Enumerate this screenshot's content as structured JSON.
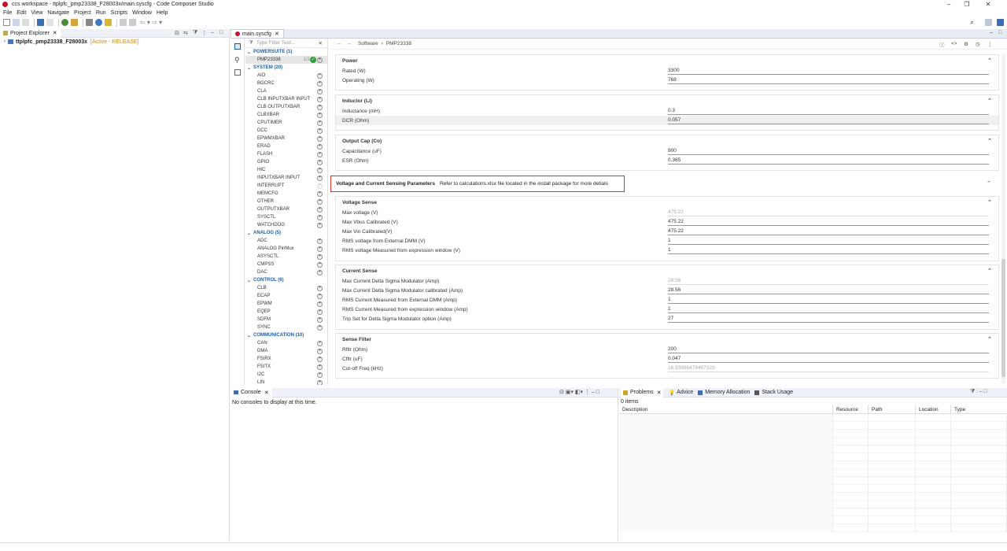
{
  "window": {
    "title": "ccs workspace - ttplpfc_pmp23338_F28003x/main.syscfg - Code Composer Studio"
  },
  "menu": [
    "File",
    "Edit",
    "View",
    "Navigate",
    "Project",
    "Run",
    "Scripts",
    "Window",
    "Help"
  ],
  "project_explorer": {
    "tab_label": "Project Explorer",
    "project_name": "ttplpfc_pmp23338_F28003x",
    "project_status": "[Active - RELEASE]"
  },
  "editor": {
    "tab_label": "main.syscfg"
  },
  "left_panel": {
    "filter_placeholder": "Type Filter Text...",
    "categories": [
      {
        "name": "POWERSUITE (1)",
        "modules": [
          {
            "name": "PMP23338",
            "count": "1/1"
          }
        ]
      },
      {
        "name": "SYSTEM (20)",
        "modules": [
          "AIO",
          "BGCRC",
          "CLA",
          "CLB INPUTXBAR INPUT",
          "CLB OUTPUTXBAR",
          "CLBXBAR",
          "CPUTIMER",
          "DCC",
          "EPWMXBAR",
          "ERAD",
          "FLASH",
          "GPIO",
          "HIC",
          "INPUTXBAR INPUT",
          "INTERRUPT",
          "MEMCFG",
          "OTHER",
          "OUTPUTXBAR",
          "SYSCTL",
          "WATCHDOG"
        ]
      },
      {
        "name": "ANALOG (5)",
        "modules": [
          "ADC",
          "ANALOG PinMux",
          "ASYSCTL",
          "CMPSS",
          "DAC"
        ]
      },
      {
        "name": "CONTROL (6)",
        "modules": [
          "CLB",
          "ECAP",
          "EPWM",
          "EQEP",
          "SDFM",
          "SYNC"
        ]
      },
      {
        "name": "COMMUNICATION (10)",
        "modules": [
          "CAN",
          "DMA",
          "FSIRX",
          "FSITX",
          "I2C",
          "LIN"
        ]
      }
    ]
  },
  "breadcrumb": {
    "root": "Software",
    "leaf": "PMP23338"
  },
  "sections": {
    "power": {
      "title": "Power",
      "fields": [
        {
          "label": "Rated (W)",
          "value": "3300"
        },
        {
          "label": "Operating (W)",
          "value": "768"
        }
      ]
    },
    "inductor": {
      "title": "Inductor (Li)",
      "fields": [
        {
          "label": "Inductance (mH)",
          "value": "0.3"
        },
        {
          "label": "DCR (Ohm)",
          "value": "0.057"
        }
      ]
    },
    "output_cap": {
      "title": "Output Cap (Co)",
      "fields": [
        {
          "label": "Capacitance (uF)",
          "value": "900"
        },
        {
          "label": "ESR (Ohm)",
          "value": "0.365"
        }
      ]
    },
    "vcsp": {
      "title": "Voltage and Current Sensing Parameters",
      "note": "Refer to calculations.xlsx file located in the install package for more detials"
    },
    "voltage_sense": {
      "title": "Voltage Sense",
      "fields": [
        {
          "label": "Max voltage (V)",
          "value": "475.22",
          "readonly": true
        },
        {
          "label": "Max Vbus Calibrated (V)",
          "value": "475.22"
        },
        {
          "label": "Max Vin Calibrated(V)",
          "value": "475.22"
        },
        {
          "label": "RMS voltage from External DMM (V)",
          "value": "1"
        },
        {
          "label": "RMS voltage Measured from expression window (V)",
          "value": "1"
        }
      ]
    },
    "current_sense": {
      "title": "Current Sense",
      "fields": [
        {
          "label": "Max Current Delta Sigma Modulator (Amp)",
          "value": "28.56",
          "readonly": true
        },
        {
          "label": "Max Current Delta Sigma Modulator calibrated (Amp)",
          "value": "28.56"
        },
        {
          "label": "RMS Current Measured from External DMM (Amp)",
          "value": "1"
        },
        {
          "label": "RMS Current Measured from expression window (Amp)",
          "value": "1"
        },
        {
          "label": "Trip Set for Delta Sigma Modulator option (Amp)",
          "value": "27"
        }
      ]
    },
    "sense_filter": {
      "title": "Sense Filter",
      "fields": [
        {
          "label": "Rfltr (Ohm)",
          "value": "200"
        },
        {
          "label": "Cfltr (uF)",
          "value": "0.047"
        },
        {
          "label": "Cut-off Freq (kHz)",
          "value": "16.93996478487329",
          "readonly": true
        }
      ]
    }
  },
  "console": {
    "tab_label": "Console",
    "message": "No consoles to display at this time."
  },
  "problems": {
    "tabs": [
      "Problems",
      "Advice",
      "Memory Allocation",
      "Stack Usage"
    ],
    "count": "0 items",
    "columns": [
      "Description",
      "Resource",
      "Path",
      "Location",
      "Type"
    ]
  },
  "colors": {
    "highlight_border": "#d9302a",
    "category_blue": "#1d5fa7",
    "check_green": "#2e9e3a"
  }
}
